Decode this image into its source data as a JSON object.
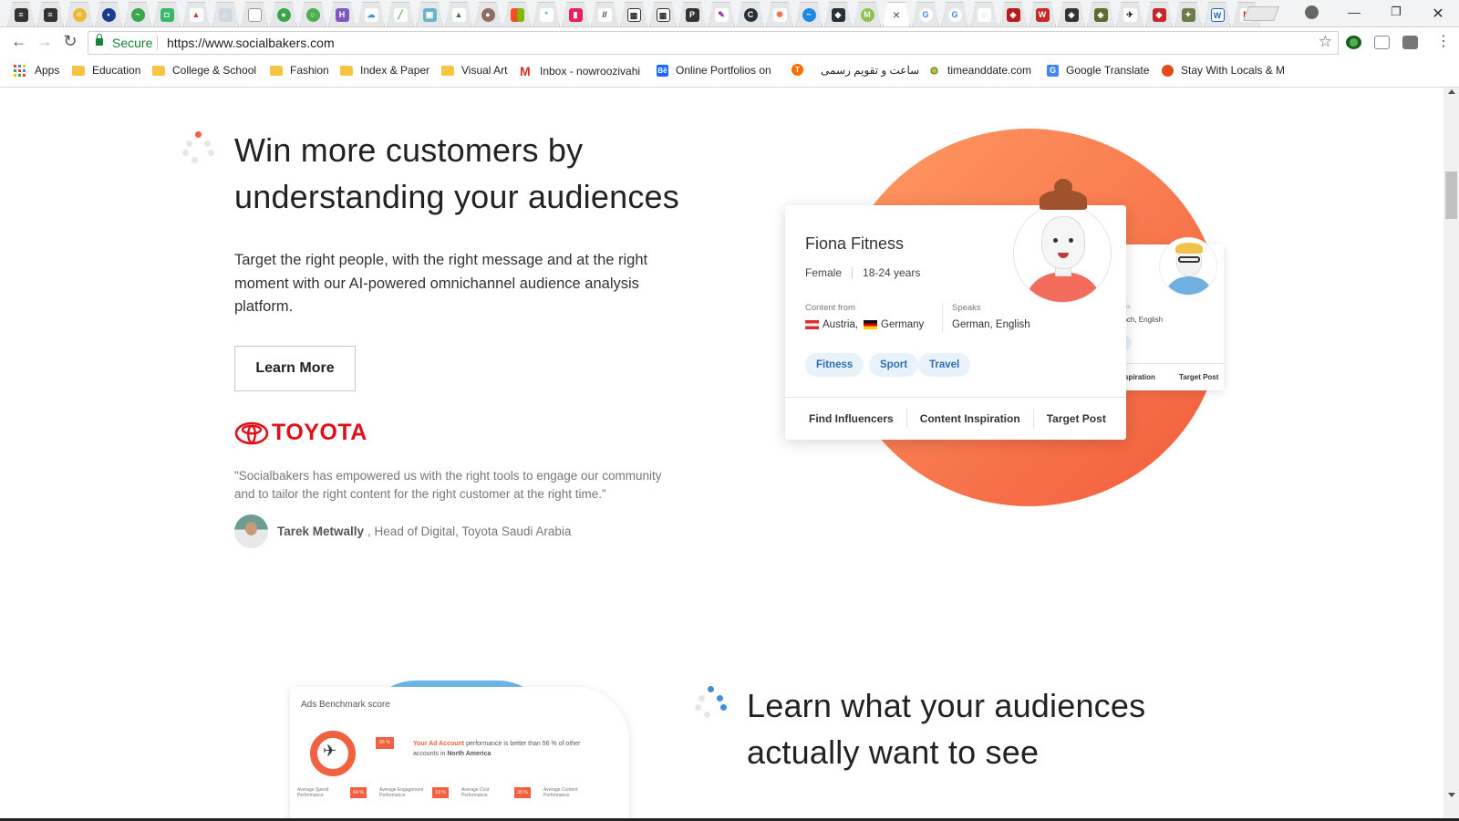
{
  "browser": {
    "active_tab_close": "×",
    "address": {
      "secure_label": "Secure",
      "url": "https://www.socialbakers.com"
    },
    "bookmarks": [
      {
        "label": "Apps",
        "icon": "apps-grid-icon"
      },
      {
        "label": "Education",
        "icon": "folder-icon"
      },
      {
        "label": "College & School",
        "icon": "folder-icon"
      },
      {
        "label": "Fashion",
        "icon": "folder-icon"
      },
      {
        "label": "Index & Paper",
        "icon": "folder-icon"
      },
      {
        "label": "Visual Art",
        "icon": "folder-icon"
      },
      {
        "label": "Inbox - nowroozivahi",
        "icon": "gmail-icon"
      },
      {
        "label": "Online Portfolios on",
        "icon": "behance-icon"
      },
      {
        "label": "",
        "icon": "orange-t-icon"
      },
      {
        "label": "ساعت و تقویم رسمی",
        "icon": "none"
      },
      {
        "label": "timeanddate.com",
        "icon": "timeanddate-icon"
      },
      {
        "label": "Google Translate",
        "icon": "google-translate-icon"
      },
      {
        "label": "Stay With Locals & M",
        "icon": "couchsurfing-icon"
      }
    ]
  },
  "section1": {
    "title_line1": "Win more customers by",
    "title_line2": "understanding your audiences",
    "lead": "Target the right people, with the right message and at the right moment with our AI-powered omnichannel audience analysis platform.",
    "cta": "Learn More",
    "brand": "TOYOTA",
    "quote": "\"Socialbakers has empowered us with the right tools to engage our community and to tailor the right content for the right customer at the right time.\"",
    "author_name": "Tarek Metwally",
    "author_role": ", Head of Digital, Toyota Saudi Arabia"
  },
  "profile_card": {
    "name": "Fiona Fitness",
    "gender": "Female",
    "age": "18-24 years",
    "content_from_label": "Content from",
    "country1": "Austria,",
    "country2": "Germany",
    "speaks_label": "Speaks",
    "languages": "German, English",
    "chips": [
      "Fitness",
      "Sport",
      "Travel"
    ],
    "actions": [
      "Find Influencers",
      "Content Inspiration",
      "Target Post"
    ]
  },
  "back_card": {
    "speaks_partial": "oaks",
    "languages_partial": "ench, English",
    "chip_partial": "ng",
    "action1_partial": "Inspiration",
    "action2": "Target Post"
  },
  "section2": {
    "title_line1": "Learn what your audiences",
    "title_line2": "actually want to see",
    "ads_title": "Ads Benchmark score",
    "ads_badge": "56 %",
    "ads_text_highlight": "Your Ad Account",
    "ads_text_rest": "performance is better than 56 % of other accounts in",
    "ads_region": "North America",
    "metrics": [
      {
        "label": "Average Spend Performance",
        "value": "64 %"
      },
      {
        "label": "Average Engagement Performance",
        "value": "19 %"
      },
      {
        "label": "Average Cost Performance",
        "value": "35 %"
      },
      {
        "label": "Average Content Performance",
        "value": ""
      }
    ]
  },
  "colors": {
    "accent_orange": "#f2613f",
    "toyota_red": "#e0101b",
    "chip_blue": "#2d6db5",
    "secure_green": "#188038"
  }
}
